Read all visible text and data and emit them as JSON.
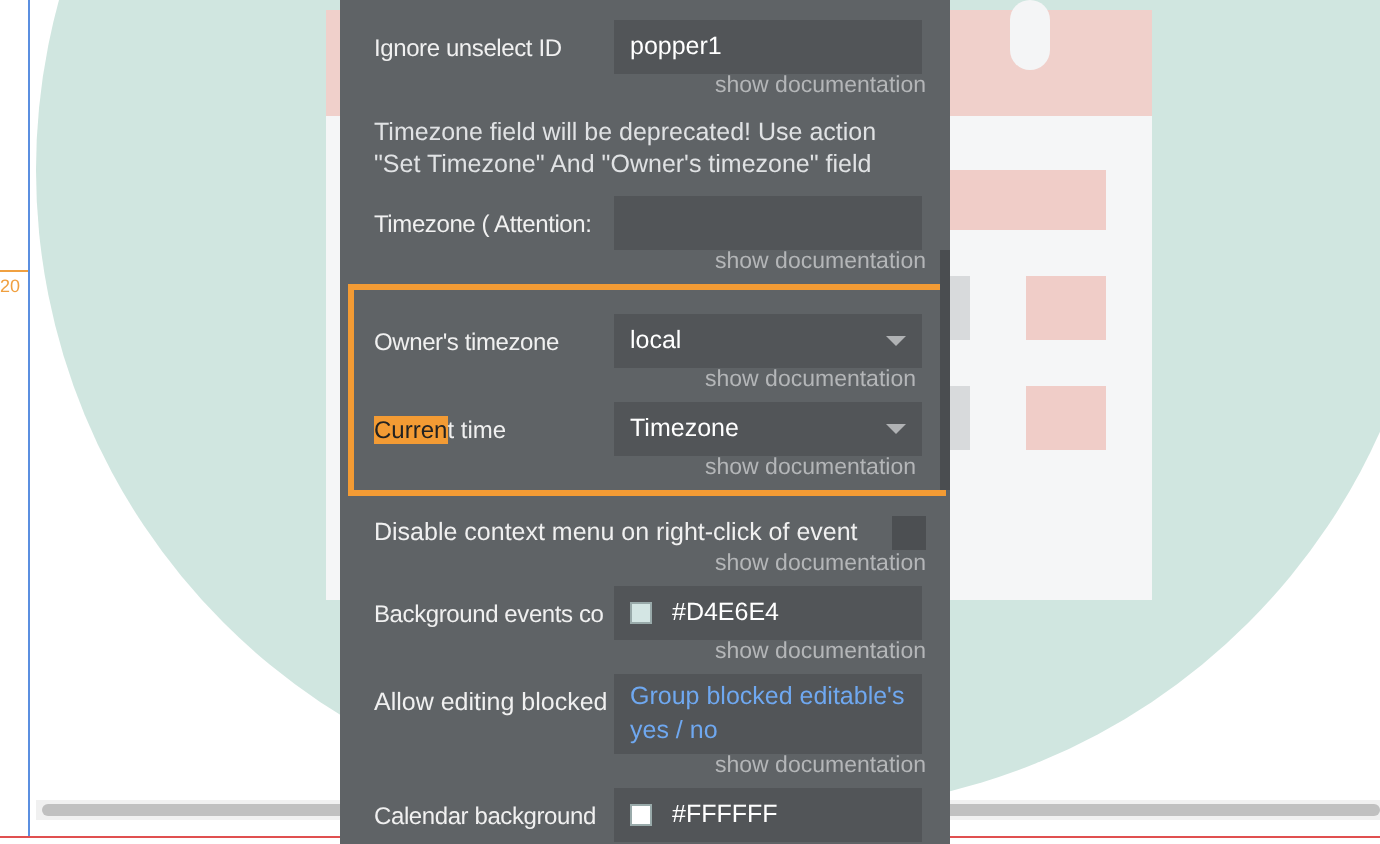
{
  "ruler": {
    "mark": "20"
  },
  "properties": [
    {
      "kind": "text",
      "label": "Ignore unselect ID",
      "value": "popper1",
      "doc": "show documentation",
      "framed": false
    },
    {
      "kind": "notice",
      "text": "Timezone field will be deprecated! Use action \"Set Timezone\" And \"Owner's timezone\" field",
      "framed": false
    },
    {
      "kind": "text",
      "label": "Timezone ( Attention:",
      "doc": "show documentation",
      "framed": false
    },
    {
      "kind": "dropdown",
      "label": "Owner's timezone",
      "value": "local",
      "doc": "show documentation",
      "framed": true
    },
    {
      "kind": "dropdown",
      "label_parts": [
        {
          "text": "Curren",
          "highlighted": true
        },
        {
          "text": "t time",
          "highlighted": false
        }
      ],
      "value": "Timezone",
      "doc": "show documentation",
      "framed": true
    },
    {
      "kind": "checkbox",
      "label": "Disable context menu on right-click of event",
      "checked": false,
      "doc": "show documentation",
      "framed": false
    },
    {
      "kind": "color",
      "label": "Background events co",
      "value": "#D4E6E4",
      "color": "#d4e6e4",
      "doc": "show documentation",
      "framed": false
    },
    {
      "kind": "expression",
      "label": "Allow editing blocked",
      "value": "Group blocked editable's yes / no",
      "doc": "show documentation",
      "framed": false
    },
    {
      "kind": "color",
      "label": "Calendar background",
      "value": "#FFFFFF",
      "color": "#ffffff",
      "framed": false
    }
  ]
}
